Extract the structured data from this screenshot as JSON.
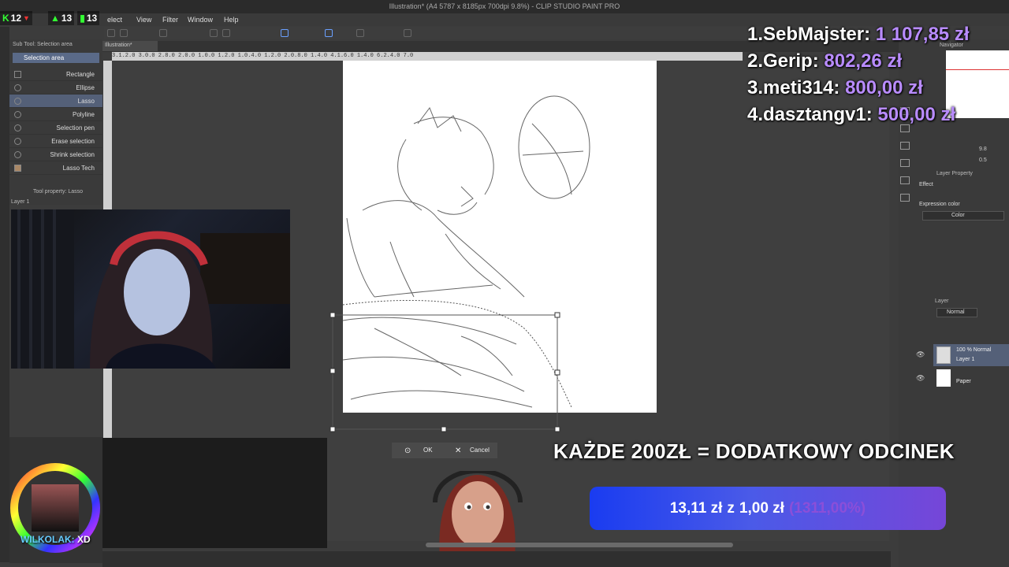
{
  "window": {
    "title": "Illustration* (A4 5787 x 8185px 700dpi 9.8%) - CLIP STUDIO PAINT PRO"
  },
  "menu": {
    "items": [
      "elect",
      "View",
      "Filter",
      "Window",
      "Help"
    ]
  },
  "stream_stats": {
    "kills": "12",
    "up": "13",
    "bars": "13"
  },
  "tabs": {
    "doc": "Illustration*"
  },
  "ruler_top": "3.1.2.0 3.0.0 2.8.0 2.0.0 1.0.0 1.2.0 1.0.4.0 1.2.0 2.0.8.0 1.4.0 4.1.6.0 1.4.0 6.2.4.0 7.0",
  "subtool": {
    "header": "Sub Tool: Selection area",
    "tab": "Selection area",
    "items": [
      "Rectangle",
      "Ellipse",
      "Lasso",
      "Polyline",
      "Selection pen",
      "Erase selection",
      "Shrink selection",
      "Lasso Tech"
    ],
    "tool_property": "Tool property: Lasso",
    "layer": "Layer 1"
  },
  "dialog": {
    "ok": "OK",
    "cancel": "Cancel"
  },
  "leaderboard": [
    {
      "rank": "1.",
      "name": "SebMajster:",
      "amount": "1 107,85 zł"
    },
    {
      "rank": "2.",
      "name": "Gerip:",
      "amount": "802,26 zł"
    },
    {
      "rank": "3.",
      "name": "meti314:",
      "amount": "800,00 zł"
    },
    {
      "rank": "4.",
      "name": "dasztangv1:",
      "amount": "500,00 zł"
    }
  ],
  "banner": "KAŻDE 200ZŁ = DODATKOWY ODCINEK",
  "goal": {
    "current": "13,11 zł",
    "sep": "z",
    "target": "1,00 zł",
    "percent": "(1311,00%)"
  },
  "chat": {
    "name": "WILKOLAK:",
    "message": "XD"
  },
  "right_panel": {
    "navigator": "Navigator",
    "zoom": "9.8",
    "rotation": "0.5",
    "layer_property": "Layer Property",
    "effect": "Effect",
    "expression_color": "Expression color",
    "color": "Color",
    "layer_tab": "Layer",
    "blend": "Normal",
    "layers": [
      {
        "opacity": "100 % Normal",
        "name": "Layer 1"
      },
      {
        "opacity": "",
        "name": "Paper"
      }
    ]
  },
  "colors": {
    "accent_purple": "#b98cff",
    "goal_blue": "#1a3cf0",
    "goal_violet": "#7646d8"
  }
}
